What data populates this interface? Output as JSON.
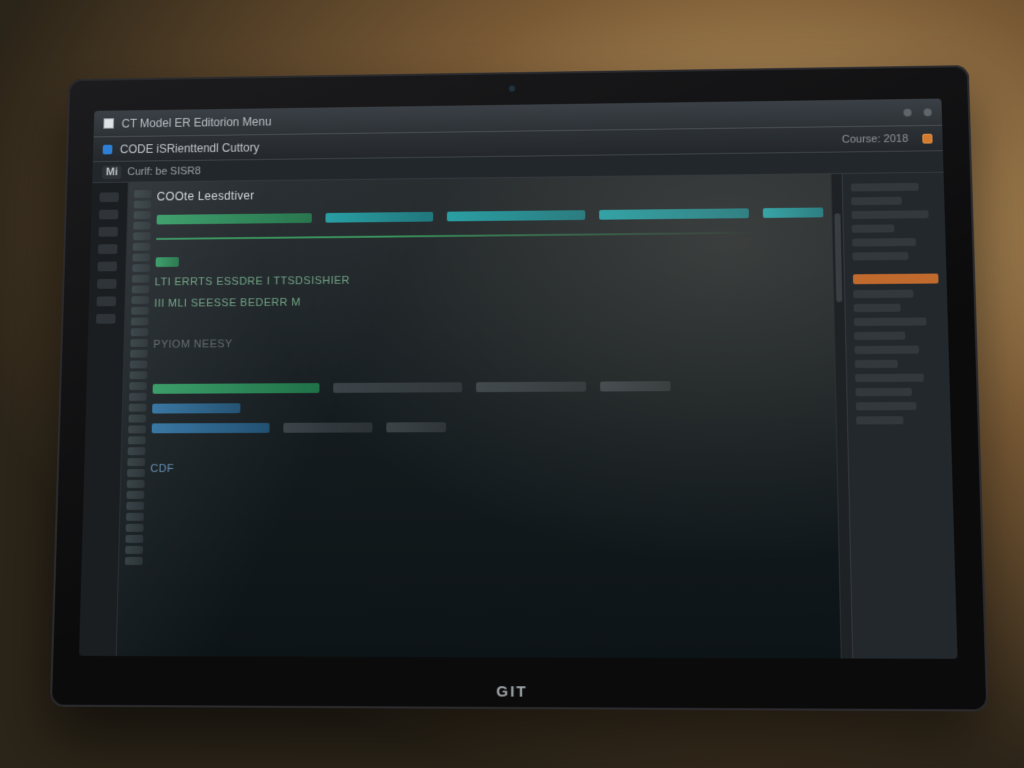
{
  "window": {
    "title": "CT Model ER Editorion Menu",
    "tab_label": "CODE iSRienttendl Cuttory",
    "status_text": "Course: 2018"
  },
  "subbar": {
    "badge": "Mi",
    "text": "Curlf: be SISR8"
  },
  "editor": {
    "heading": "COOte Leesdtiver",
    "labels": {
      "l1": "LTI ERRTS  ESSDRE I TTSDSISHIER",
      "l2": "III MLI SEESSE BEDERR  M",
      "l3": "PYIOM NEESY",
      "l4": "CDF"
    }
  },
  "brand": "GIT"
}
